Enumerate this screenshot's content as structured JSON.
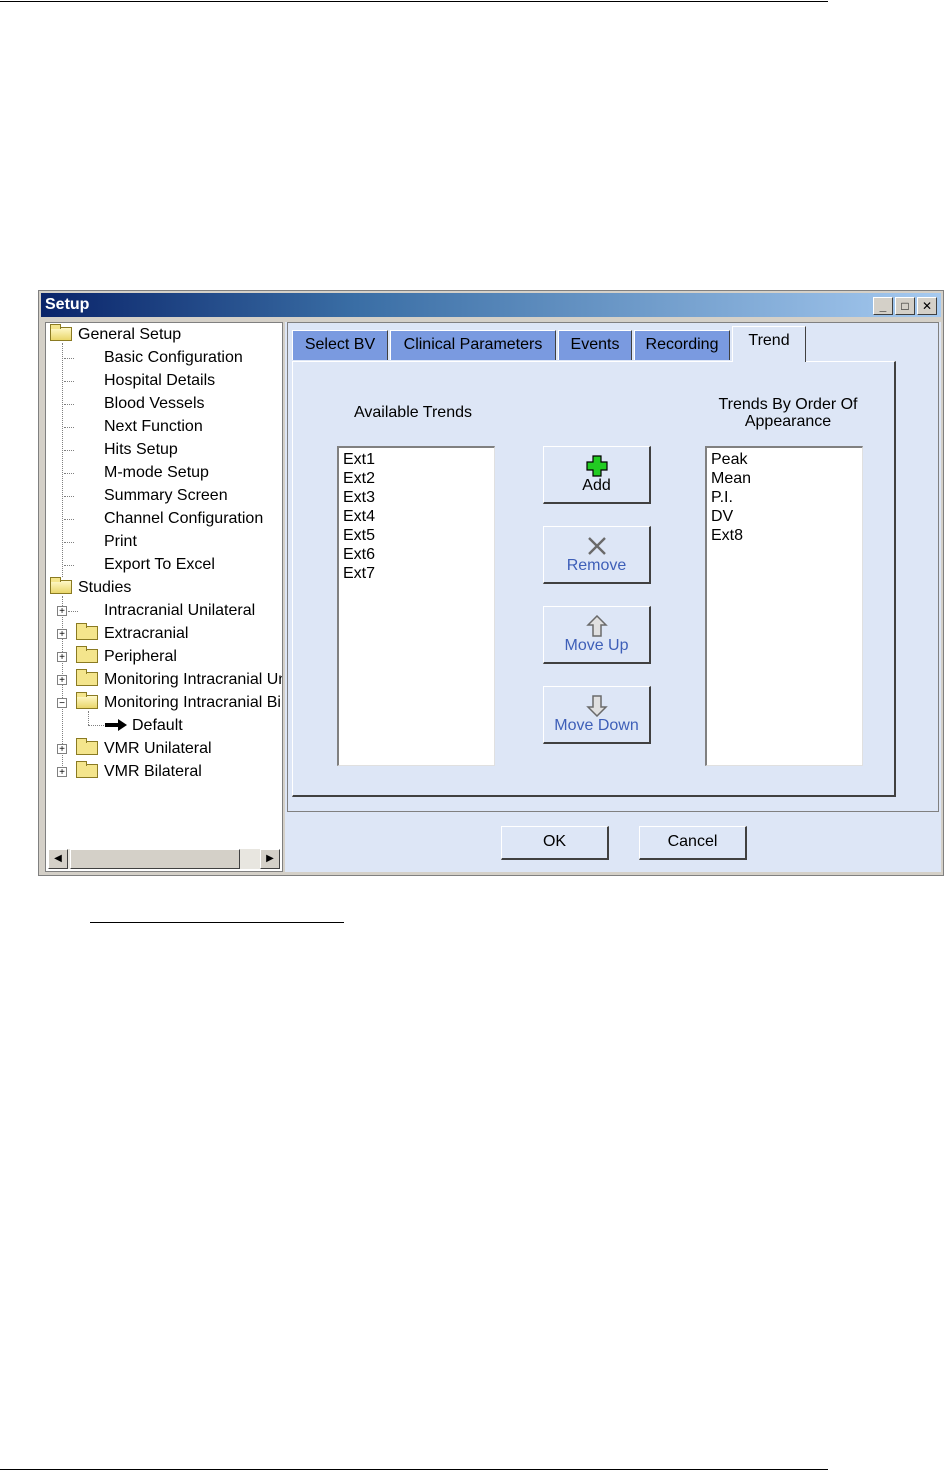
{
  "window": {
    "title": "Setup"
  },
  "tree": {
    "general_setup": "General Setup",
    "general_items": [
      "Basic Configuration",
      "Hospital Details",
      "Blood Vessels",
      "Next Function",
      "Hits Setup",
      "M-mode Setup",
      "Summary Screen",
      "Channel Configuration",
      "Print",
      "Export To Excel"
    ],
    "studies": "Studies",
    "study_items": [
      "Intracranial Unilateral",
      "Extracranial",
      "Peripheral",
      "Monitoring Intracranial Uni",
      "Monitoring Intracranial Bila",
      "Default",
      "VMR Unilateral",
      "VMR Bilateral"
    ]
  },
  "tabs": [
    "Select BV",
    "Clinical Parameters",
    "Events",
    "Recording",
    "Trend"
  ],
  "trend": {
    "available_label": "Available Trends",
    "available": [
      "Ext1",
      "Ext2",
      "Ext3",
      "Ext4",
      "Ext5",
      "Ext6",
      "Ext7"
    ],
    "order_label_line1": "Trends By Order Of",
    "order_label_line2": "Appearance",
    "ordered": [
      "Peak",
      "Mean",
      "P.I.",
      "DV",
      "Ext8"
    ],
    "add": "Add",
    "remove": "Remove",
    "move_up": "Move Up",
    "move_down": "Move Down"
  },
  "buttons": {
    "ok": "OK",
    "cancel": "Cancel"
  },
  "colors": {
    "tab_inactive": "#7a9ae0",
    "panel": "#dde6f6",
    "add_icon": "#22cc22"
  }
}
